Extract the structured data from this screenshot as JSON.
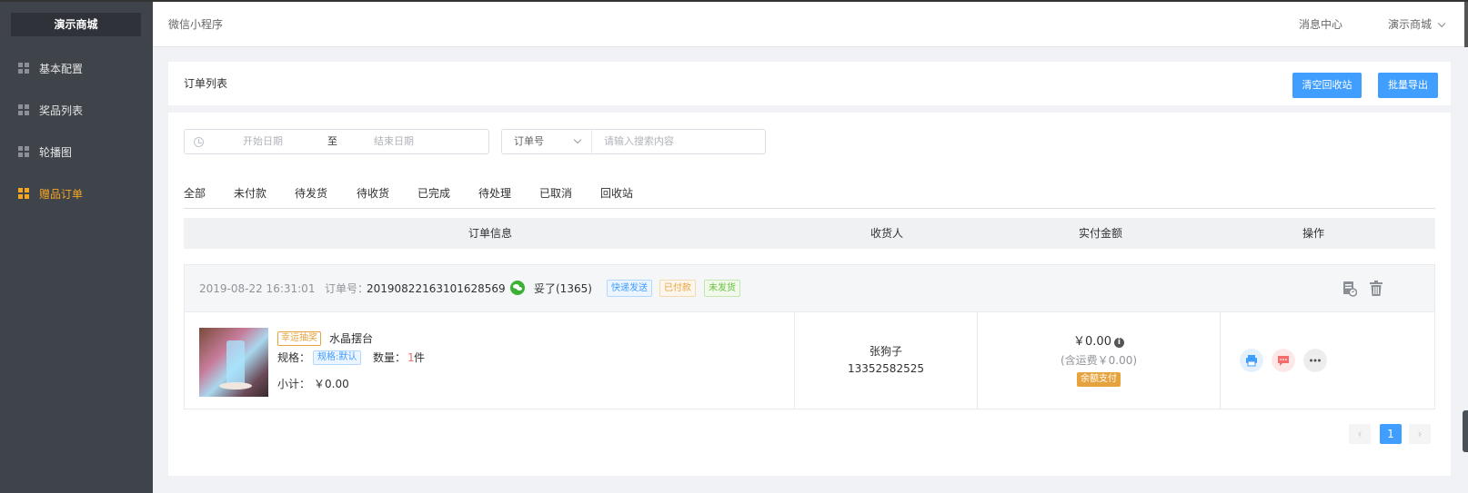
{
  "sidebar": {
    "brand": "演示商城",
    "items": [
      {
        "label": "基本配置",
        "active": false
      },
      {
        "label": "奖品列表",
        "active": false
      },
      {
        "label": "轮播图",
        "active": false
      },
      {
        "label": "赠品订单",
        "active": true
      }
    ]
  },
  "header": {
    "breadcrumb": "微信小程序",
    "message_center": "消息中心",
    "shop_menu": "演示商城"
  },
  "page": {
    "title": "订单列表",
    "clear_recycle_button": "清空回收站",
    "batch_export_button": "批量导出"
  },
  "filters": {
    "start_date_placeholder": "开始日期",
    "range_separator": "至",
    "end_date_placeholder": "结束日期",
    "search_type": "订单号",
    "search_placeholder": "请输入搜索内容"
  },
  "tabs": [
    "全部",
    "未付款",
    "待发货",
    "待收货",
    "已完成",
    "待处理",
    "已取消",
    "回收站"
  ],
  "table_headers": {
    "order_info": "订单信息",
    "receiver": "收货人",
    "paid_amount": "实付金额",
    "actions": "操作"
  },
  "orders": [
    {
      "datetime": "2019-08-22 16:31:01",
      "order_no_label": "订单号：",
      "order_no": "20190822163101628569",
      "platform_icon": "wechat-icon",
      "nickname": "妥了(1365)",
      "tags": [
        "快递发送",
        "已付款",
        "未发货"
      ],
      "product": {
        "badge": "幸运抽奖",
        "name": "水晶摆台",
        "spec_label": "规格：",
        "spec_value": "规格:默认",
        "qty_label": "数量：",
        "qty_value": "1",
        "qty_unit": "件",
        "subtotal_label": "小计：",
        "subtotal_value": "￥0.00"
      },
      "receiver_name": "张狗子",
      "receiver_phone": "13352582525",
      "amount": "￥0.00",
      "shipping_note": "(含运费￥0.00)",
      "pay_method": "余额支付"
    }
  ],
  "pagination": {
    "current": "1",
    "prev_icon": "chevron-left-icon",
    "next_icon": "chevron-right-icon"
  },
  "colors": {
    "primary": "#409eff",
    "sidebar_bg": "#3f434a",
    "sidebar_active": "#f5a623",
    "price_red": "#f56c6c",
    "pay_tag": "#e6a23c"
  }
}
